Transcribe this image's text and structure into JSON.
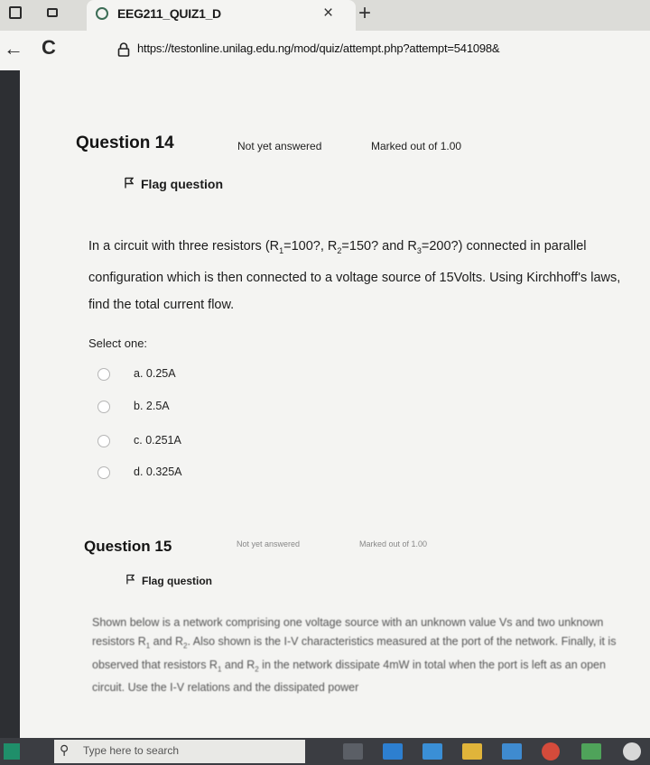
{
  "browser": {
    "tab_title": "EEG211_QUIZ1_D",
    "close_glyph": "×",
    "new_tab_glyph": "+",
    "back_glyph": "←",
    "reload_glyph": "C",
    "url": "https://testonline.unilag.edu.ng/mod/quiz/attempt.php?attempt=541098&"
  },
  "q14": {
    "title": "Question 14",
    "state": "Not yet answered",
    "mark": "Marked out of 1.00",
    "flag_label": "Flag question",
    "text_a": "In a circuit with three resistors (R",
    "sub1": "1",
    "text_b": "=100?, R",
    "sub2": "2",
    "text_c": "=150? and R",
    "sub3": "3",
    "text_d": "=200?) connected in parallel configuration which is then connected to a voltage source of 15Volts. Using Kirchhoff's laws, find the total current flow.",
    "select_label": "Select one:",
    "options": [
      "a. 0.25A",
      "b. 2.5A",
      "c. 0.251A",
      "d. 0.325A"
    ]
  },
  "q15": {
    "title": "Question 15",
    "state": "Not yet answered",
    "mark": "Marked out of 1.00",
    "flag_label": "Flag question",
    "text_a": "Shown below is a network comprising one voltage source with an unknown value Vs and two unknown resistors R",
    "sub1": "1",
    "text_b": " and R",
    "sub2": "2",
    "text_c": ". Also shown is the I-V characteristics measured at the port of the network. Finally, it is observed that resistors R",
    "sub3": "1",
    "text_d": " and R",
    "sub4": "2",
    "text_e": " in the network dissipate 4mW in total when the port is left as an open circuit. Use the I-V relations and the dissipated power"
  },
  "taskbar": {
    "search_placeholder": "Type here to search"
  },
  "colors": {
    "page_bg": "#f4f4f2",
    "taskbar_bg": "#3b3d42",
    "left_strip": "#2d2f33"
  }
}
